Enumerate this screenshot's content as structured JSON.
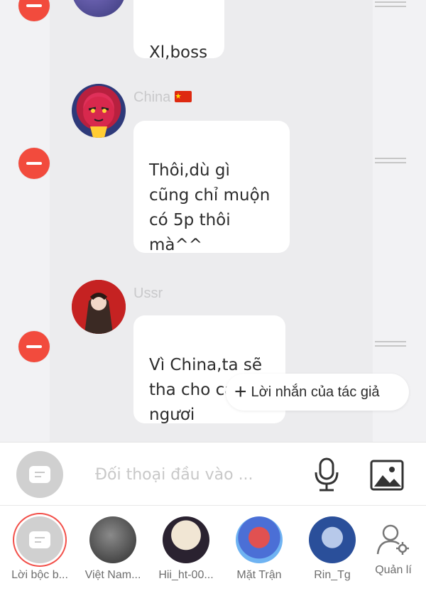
{
  "messages": [
    {
      "name": "",
      "text": "Xl,boss"
    },
    {
      "name": "China",
      "text": "Thôi,dù gì\ncũng chỉ muộn\ncó 5p thôi\nmà^^"
    },
    {
      "name": "Ussr",
      "text": "Vì China,ta sẽ\ntha cho các\nngươi"
    }
  ],
  "author_note": {
    "label": "Lời nhắn của tác giả"
  },
  "input_bar": {
    "placeholder": "Đối thoại đầu vào ..."
  },
  "characters": [
    {
      "label": "Lời bộc b..."
    },
    {
      "label": "Việt Nam..."
    },
    {
      "label": "Hii_ht-00..."
    },
    {
      "label": "Mặt Trận"
    },
    {
      "label": "Rin_Tg"
    }
  ],
  "manage": {
    "label": "Quản lí"
  },
  "colors": {
    "delete": "#f24b3d",
    "narrator_ring": "#f2504a",
    "bubble": "#ffffff"
  }
}
